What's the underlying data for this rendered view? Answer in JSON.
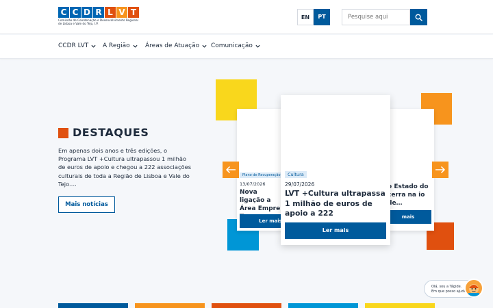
{
  "logo": {
    "letters": [
      "C",
      "C",
      "D",
      "R",
      "L",
      "V",
      "T"
    ],
    "letter_colors": [
      "#0066b3",
      "#0066b3",
      "#0066b3",
      "#0066b3",
      "#e0500f",
      "#f7941d",
      "#e0500f"
    ],
    "subtitle_line1": "Comissão de Coordenação e Desenvolvimento Regional",
    "subtitle_line2": "de Lisboa e Vale do Tejo, I.P."
  },
  "header": {
    "lang_en": "EN",
    "lang_pt": "PT",
    "active_lang": "PT",
    "search_placeholder": "Pesquise aqui",
    "search_icon": "search-icon"
  },
  "nav": {
    "items": [
      {
        "label": "CCDR LVT"
      },
      {
        "label": "A Região"
      },
      {
        "label": "Áreas de Atuação"
      },
      {
        "label": "Comunicação"
      }
    ]
  },
  "highlights": {
    "title": "DESTAQUES",
    "description": "Em apenas dois anos e três edições, o Programa LVT +Cultura ultrapassou 1 milhão de euros de apoio e chegou a 222 associações culturais de toda a Região de Lisboa e Vale do Tejo.…",
    "more_button": "Mais notícias"
  },
  "carousel": {
    "prev_icon": "arrow-left-icon",
    "next_icon": "arrow-right-icon",
    "cards": [
      {
        "tag": "Plano de Recuperação",
        "date": "13/07/2026",
        "title": "Nova ligação a Área Empre Torres Vedras",
        "button": "Ler mais"
      },
      {
        "tag": "Cultura",
        "date": "29/07/2026",
        "title": "LVT +Cultura ultrapassa 1 milhão de euros de apoio a 222 associações…",
        "button": "Ler mais"
      },
      {
        "tag": "",
        "date": "",
        "title": "o Estado do cerra na io de…",
        "button": "mais"
      }
    ]
  },
  "assistant": {
    "line1": "Olá, sou a Tágide.",
    "line2": "Em que posso ajudar?"
  },
  "colors": {
    "primary": "#005a9c",
    "orange": "#f7941d",
    "red_orange": "#e0500f",
    "yellow": "#f9d71c",
    "light_blue": "#0096d6"
  }
}
